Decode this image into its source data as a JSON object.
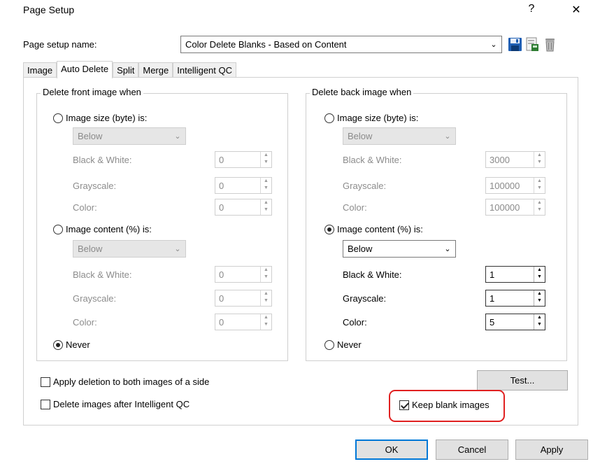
{
  "window": {
    "title": "Page Setup",
    "help_glyph": "?",
    "close_glyph": "✕"
  },
  "setup": {
    "name_label": "Page setup name:",
    "name_value": "Color Delete Blanks - Based on Content",
    "icons": [
      "save-icon",
      "save-as-icon",
      "delete-icon"
    ]
  },
  "tabs": [
    "Image",
    "Auto Delete",
    "Split",
    "Merge",
    "Intelligent QC"
  ],
  "active_tab": "Auto Delete",
  "front": {
    "title": "Delete front image when",
    "size_label": "Image size (byte) is:",
    "size_mode": "Below",
    "size_bw_label": "Black & White:",
    "size_bw": "0",
    "size_gray_label": "Grayscale:",
    "size_gray": "0",
    "size_color_label": "Color:",
    "size_color": "0",
    "content_label": "Image content (%) is:",
    "content_mode": "Below",
    "content_bw_label": "Black & White:",
    "content_bw": "0",
    "content_gray_label": "Grayscale:",
    "content_gray": "0",
    "content_color_label": "Color:",
    "content_color": "0",
    "never_label": "Never",
    "selected": "never"
  },
  "back": {
    "title": "Delete back image when",
    "size_label": "Image size (byte) is:",
    "size_mode": "Below",
    "size_bw_label": "Black & White:",
    "size_bw": "3000",
    "size_gray_label": "Grayscale:",
    "size_gray": "100000",
    "size_color_label": "Color:",
    "size_color": "100000",
    "content_label": "Image content (%) is:",
    "content_mode": "Below",
    "content_bw_label": "Black & White:",
    "content_bw": "1",
    "content_gray_label": "Grayscale:",
    "content_gray": "1",
    "content_color_label": "Color:",
    "content_color": "5",
    "never_label": "Never",
    "selected": "content"
  },
  "options": {
    "apply_both_label": "Apply deletion to both images of a side",
    "apply_both_checked": false,
    "delete_after_qc_label": "Delete images after Intelligent QC",
    "delete_after_qc_checked": false,
    "keep_blank_label": "Keep blank images",
    "keep_blank_checked": true
  },
  "buttons": {
    "test": "Test...",
    "ok": "OK",
    "cancel": "Cancel",
    "apply": "Apply"
  },
  "colors": {
    "highlight": "#e02020",
    "focus": "#0078d7",
    "disabled_text": "#8c8c8c"
  }
}
